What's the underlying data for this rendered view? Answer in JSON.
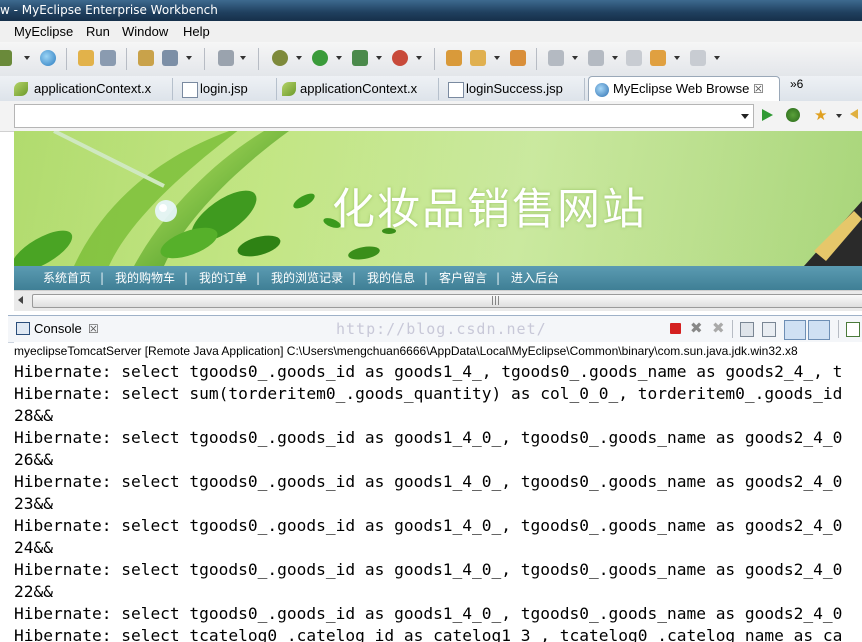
{
  "window": {
    "title": "w - MyEclipse Enterprise Workbench"
  },
  "menu": {
    "items": [
      "MyEclipse",
      "Run",
      "Window",
      "Help"
    ]
  },
  "tabs": [
    {
      "label": "applicationContext.x",
      "icon": "spring-xml-icon"
    },
    {
      "label": "login.jsp",
      "icon": "jsp-file-icon"
    },
    {
      "label": "applicationContext.x",
      "icon": "spring-xml-icon"
    },
    {
      "label": "loginSuccess.jsp",
      "icon": "jsp-file-icon"
    },
    {
      "label": "MyEclipse Web Browse",
      "icon": "globe-icon",
      "active": true,
      "close": "☒"
    }
  ],
  "tabs_overflow": {
    "label": "»6"
  },
  "browser": {
    "address": ""
  },
  "site": {
    "title": "化妆品销售网站",
    "nav": [
      "系统首页",
      "我的购物车",
      "我的订单",
      "我的浏览记录",
      "我的信息",
      "客户留言",
      "进入后台"
    ],
    "separator": "|"
  },
  "console": {
    "tab_label": "Console",
    "tab_close": "☒",
    "watermark": "http://blog.csdn.net/",
    "process": "myeclipseTomcatServer [Remote Java Application] C:\\Users\\mengchuan6666\\AppData\\Local\\MyEclipse\\Common\\binary\\com.sun.java.jdk.win32.x8",
    "lines": [
      "Hibernate: select tgoods0_.goods_id as goods1_4_, tgoods0_.goods_name as goods2_4_, t",
      "Hibernate: select sum(torderitem0_.goods_quantity) as col_0_0_, torderitem0_.goods_id",
      "28&&",
      "Hibernate: select tgoods0_.goods_id as goods1_4_0_, tgoods0_.goods_name as goods2_4_0",
      "26&&",
      "Hibernate: select tgoods0_.goods_id as goods1_4_0_, tgoods0_.goods_name as goods2_4_0",
      "23&&",
      "Hibernate: select tgoods0_.goods_id as goods1_4_0_, tgoods0_.goods_name as goods2_4_0",
      "24&&",
      "Hibernate: select tgoods0_.goods_id as goods1_4_0_, tgoods0_.goods_name as goods2_4_0",
      "22&&",
      "Hibernate: select tgoods0_.goods_id as goods1_4_0_, tgoods0_.goods_name as goods2_4_0",
      "Hibernate: select tcatelog0_.catelog_id as catelog1_3_, tcatelog0_.catelog_name as ca"
    ]
  },
  "colors": {
    "nav_bar": "#4a8ba1",
    "banner": "#d8ef9c",
    "title_bar": "#1f3f5e"
  }
}
